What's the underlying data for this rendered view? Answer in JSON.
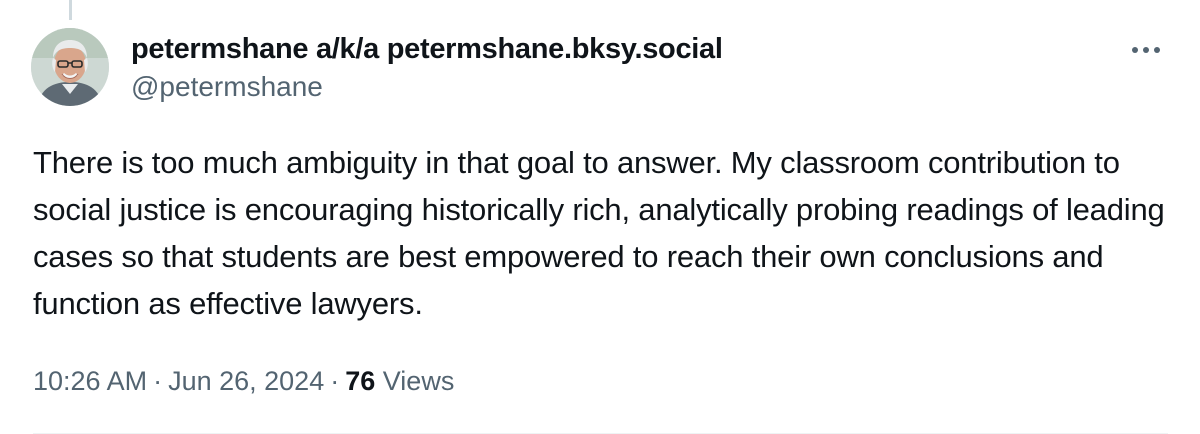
{
  "tweet": {
    "author": {
      "display_name": "petermshane a/k/a petermshane.bksy.social",
      "handle": "@petermshane",
      "avatar_icon": "profile-photo-avatar"
    },
    "more_icon": "more-horizontal-icon",
    "text": "There is too much ambiguity in that goal to answer. My classroom contribution to social justice is encouraging historically rich, analytically probing readings of leading cases so that students are best empowered to reach their own conclusions and function as effective lawyers.",
    "time": "10:26 AM",
    "separator": "·",
    "date": "Jun 26, 2024",
    "views_count": "76",
    "views_label": "Views"
  },
  "colors": {
    "text_primary": "#0f1419",
    "text_secondary": "#536471",
    "thread_line": "#cfd9de",
    "divider": "#eff3f4"
  }
}
